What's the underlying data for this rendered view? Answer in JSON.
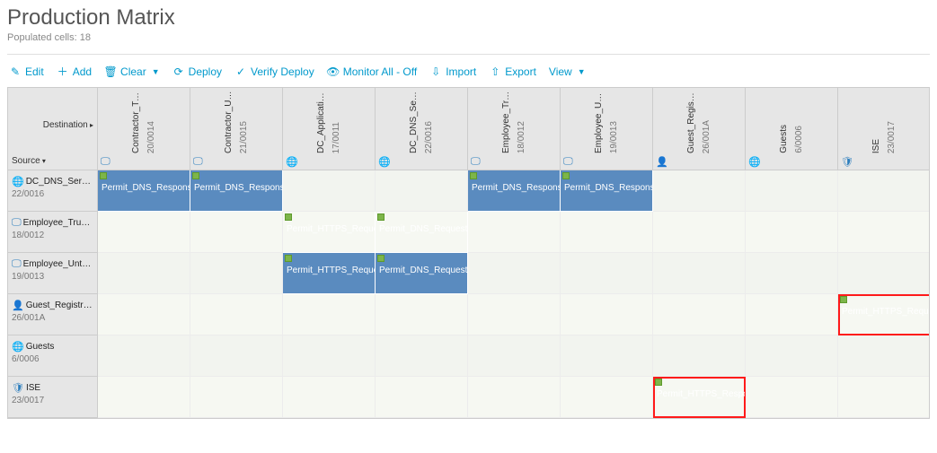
{
  "header": {
    "title": "Production Matrix",
    "subtitle_prefix": "Populated cells: ",
    "populated_cells": 18
  },
  "toolbar": {
    "edit": "Edit",
    "add": "Add",
    "clear": "Clear",
    "deploy": "Deploy",
    "verify_deploy": "Verify Deploy",
    "monitor": "Monitor All - Off",
    "import": "Import",
    "export": "Export",
    "view": "View"
  },
  "matrix": {
    "corner": {
      "destination_label": "Destination",
      "source_label": "Source"
    },
    "columns": [
      {
        "name": "Contractor_Trus...",
        "id": "20/0014",
        "icon": "monitor"
      },
      {
        "name": "Contractor_Untr...",
        "id": "21/0015",
        "icon": "monitor"
      },
      {
        "name": "DC_Application_...",
        "id": "17/0011",
        "icon": "globe"
      },
      {
        "name": "DC_DNS_Servers",
        "id": "22/0016",
        "icon": "globe"
      },
      {
        "name": "Employee_Truste...",
        "id": "18/0012",
        "icon": "monitor"
      },
      {
        "name": "Employee_Untrus...",
        "id": "19/0013",
        "icon": "monitor"
      },
      {
        "name": "Guest_Registrat...",
        "id": "26/001A",
        "icon": "user"
      },
      {
        "name": "Guests",
        "id": "6/0006",
        "icon": "globe"
      },
      {
        "name": "ISE",
        "id": "23/0017",
        "icon": "shield"
      }
    ],
    "rows": [
      {
        "name": "DC_DNS_Servers",
        "id": "22/0016",
        "icon": "globe"
      },
      {
        "name": "Employee_Truste...",
        "id": "18/0012",
        "icon": "monitor"
      },
      {
        "name": "Employee_Untrus...",
        "id": "19/0013",
        "icon": "monitor"
      },
      {
        "name": "Guest_Registrat...",
        "id": "26/001A",
        "icon": "user"
      },
      {
        "name": "Guests",
        "id": "6/0006",
        "icon": "globe"
      },
      {
        "name": "ISE",
        "id": "23/0017",
        "icon": "shield"
      }
    ],
    "cells": [
      {
        "row": 0,
        "col": 0,
        "label": "Permit_DNS_Respons",
        "highlight": false
      },
      {
        "row": 0,
        "col": 1,
        "label": "Permit_DNS_Respons",
        "highlight": false
      },
      {
        "row": 0,
        "col": 4,
        "label": "Permit_DNS_Respons",
        "highlight": false
      },
      {
        "row": 0,
        "col": 5,
        "label": "Permit_DNS_Respons",
        "highlight": false
      },
      {
        "row": 1,
        "col": 2,
        "label": "Permit_HTTPS_Reque",
        "highlight": false
      },
      {
        "row": 1,
        "col": 3,
        "label": "Permit_DNS_Request",
        "highlight": false
      },
      {
        "row": 2,
        "col": 2,
        "label": "Permit_HTTPS_Reque",
        "highlight": false
      },
      {
        "row": 2,
        "col": 3,
        "label": "Permit_DNS_Request",
        "highlight": false
      },
      {
        "row": 3,
        "col": 8,
        "label": "Permit_HTTPS_Requ",
        "highlight": true
      },
      {
        "row": 5,
        "col": 6,
        "label": "Permit_HTTPS_Respo",
        "highlight": true
      }
    ]
  }
}
